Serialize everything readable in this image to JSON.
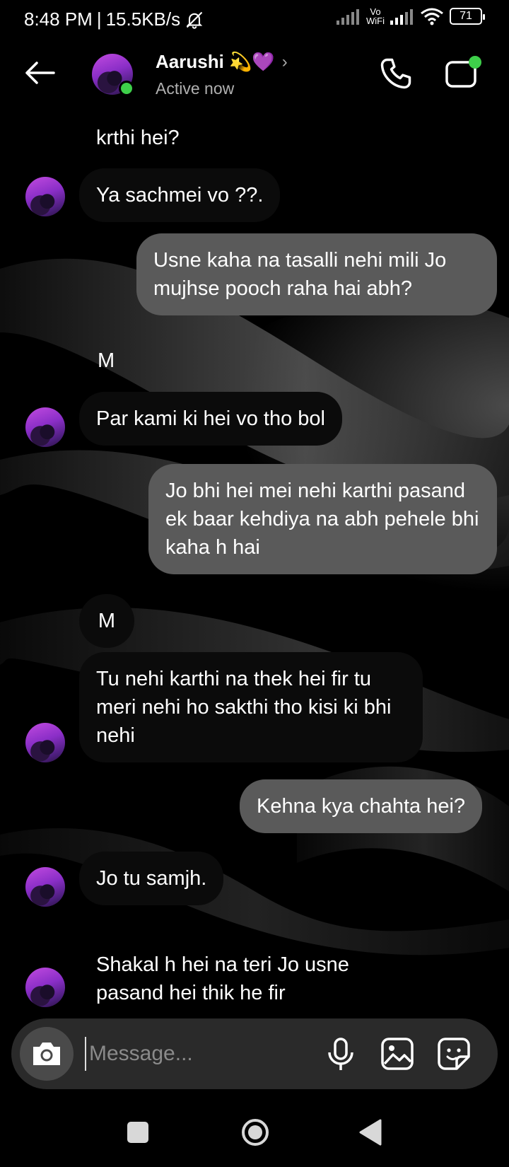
{
  "status_bar": {
    "time": "8:48 PM",
    "separator": "|",
    "speed": "15.5KB/s",
    "vowifi_top": "Vo",
    "vowifi_bottom": "WiFi",
    "battery": "71"
  },
  "header": {
    "contact_name": "Aarushi 💫💜",
    "chevron": "›",
    "status": "Active now",
    "icons": {
      "back": "back-arrow-icon",
      "call": "phone-icon",
      "video": "video-camera-icon"
    },
    "online_color": "#3ecf4a"
  },
  "messages": [
    {
      "direction": "in",
      "text": "krthi hei?"
    },
    {
      "direction": "in",
      "text": "Ya sachmei vo ??."
    },
    {
      "direction": "out",
      "text": "Usne kaha na tasalli nehi mili Jo mujhse pooch raha hai abh?"
    },
    {
      "direction": "in",
      "sender_initial": "M"
    },
    {
      "direction": "in",
      "text": "Par kami ki hei vo tho bol"
    },
    {
      "direction": "out",
      "text": "Jo bhi hei mei nehi karthi pasand ek baar kehdiya na abh pehele bhi kaha h hai"
    },
    {
      "direction": "in",
      "sender_initial": "M"
    },
    {
      "direction": "in",
      "text": "Tu nehi karthi na thek hei fir tu meri nehi ho sakthi tho kisi ki bhi nehi"
    },
    {
      "direction": "out",
      "text": "Kehna kya chahta hei?"
    },
    {
      "direction": "in",
      "text": "Jo tu samjh."
    },
    {
      "direction": "in",
      "text": "Shakal h hei na teri Jo usne pasand hei thik he fir"
    }
  ],
  "composer": {
    "placeholder": "Message...",
    "icons": {
      "camera": "camera-icon",
      "mic": "microphone-icon",
      "gallery": "image-icon",
      "sticker": "sticker-icon"
    }
  },
  "colors": {
    "background": "#000000",
    "outgoing_bubble": "#5a5a5a",
    "incoming_bubble": "#0b0b0b",
    "composer": "#2a2a2a",
    "online": "#3ecf4a"
  }
}
